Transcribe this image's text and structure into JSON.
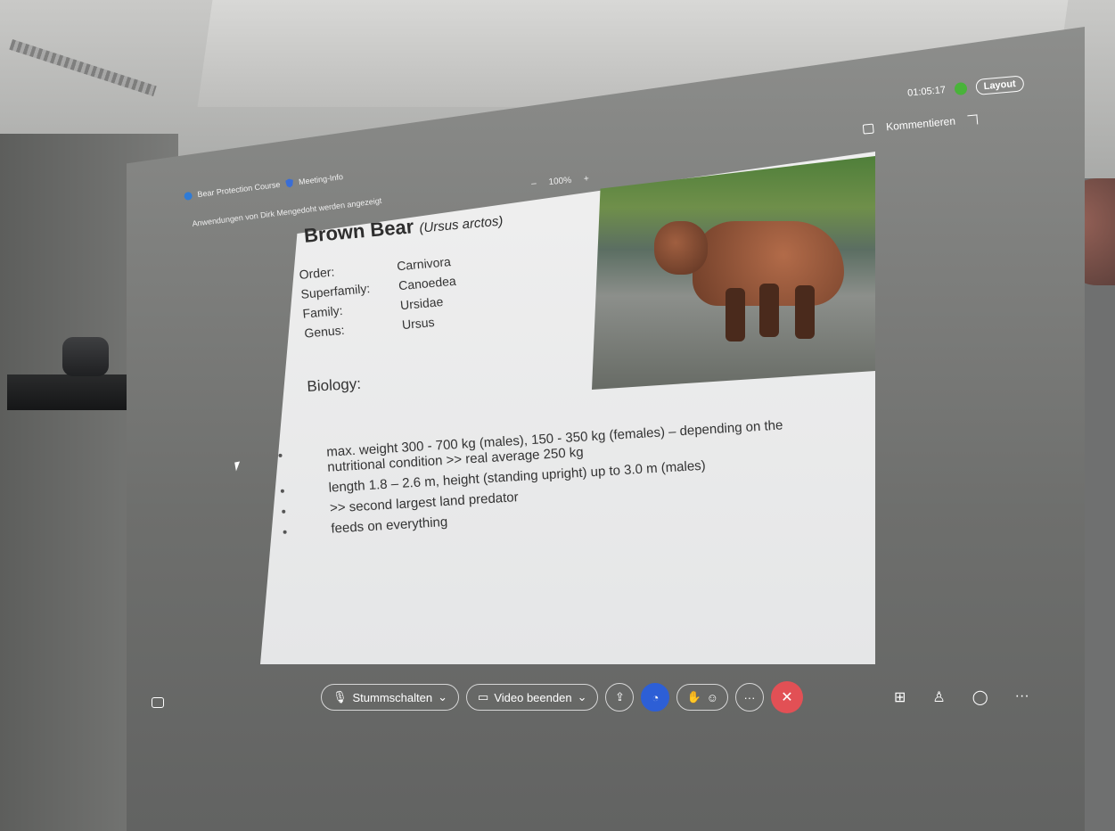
{
  "meeting": {
    "course_title": "Bear Protection Course",
    "meeting_info": "Meeting-Info",
    "share_note": "Anwendungen von Dirk Mengedoht werden angezeigt",
    "zoom_minus": "–",
    "zoom_level": "100%",
    "zoom_plus": "+"
  },
  "top_right": {
    "timer": "01:05:17",
    "layout_label": "Layout",
    "comment_label": "Kommentieren"
  },
  "slide": {
    "title_main": "Brown Bear",
    "title_latin": "(Ursus arctos)",
    "taxonomy": [
      {
        "key": "Order:",
        "value": "Carnivora"
      },
      {
        "key": "Superfamily:",
        "value": "Canoedea"
      },
      {
        "key": "Family:",
        "value": "Ursidae"
      },
      {
        "key": "Genus:",
        "value": "Ursus"
      }
    ],
    "biology_heading": "Biology:",
    "bullets": [
      "max. weight 300 - 700 kg (males), 150 - 350 kg (females) – depending on the nutritional condition >> real average 250 kg",
      "length 1.8 – 2.6 m, height (standing upright) up to 3.0 m (males)",
      ">> second largest land predator",
      "feeds on everything"
    ]
  },
  "controls": {
    "mute_label": "Stummschalten",
    "video_label": "Video beenden",
    "more_label": "···",
    "end_label": "✕",
    "caret": "⌄",
    "right_more": "···"
  },
  "icons": {
    "mic": "mic-icon",
    "video": "video-icon",
    "share": "share-icon",
    "copilot": "copilot-icon",
    "hand": "raise-hand-icon",
    "reactions": "emoji-icon",
    "apps": "apps-icon",
    "people": "people-icon",
    "chat": "chat-icon"
  },
  "colors": {
    "end_call": "#e25055",
    "signal": "#49b33a",
    "copilot": "#2d5fd6"
  }
}
